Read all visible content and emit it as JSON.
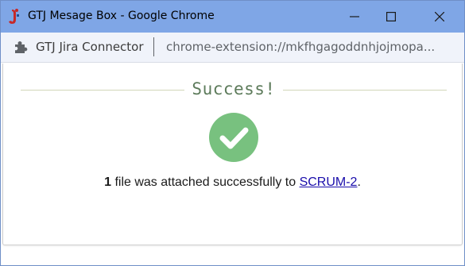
{
  "window": {
    "title": "GTJ Mesage Box - Google Chrome",
    "app_icon": "gtj-logo-icon",
    "controls": {
      "minimize": "minimize-icon",
      "maximize": "maximize-icon",
      "close": "close-icon"
    }
  },
  "addressbar": {
    "extension_icon": "puzzle-piece-icon",
    "extension_name": "GTJ Jira Connector",
    "url": "chrome-extension://mkfhgagoddnhjojmopa..."
  },
  "dialog": {
    "heading": "Success!",
    "status_icon": "check-circle-icon",
    "message": {
      "count": "1",
      "text": " file was attached successfully to ",
      "issue_key": "SCRUM-2",
      "suffix": "."
    }
  },
  "colors": {
    "titlebar": "#7fa6e6",
    "heading": "#5d7b5b",
    "success_green": "#78c17f",
    "link": "#1a0dab"
  }
}
